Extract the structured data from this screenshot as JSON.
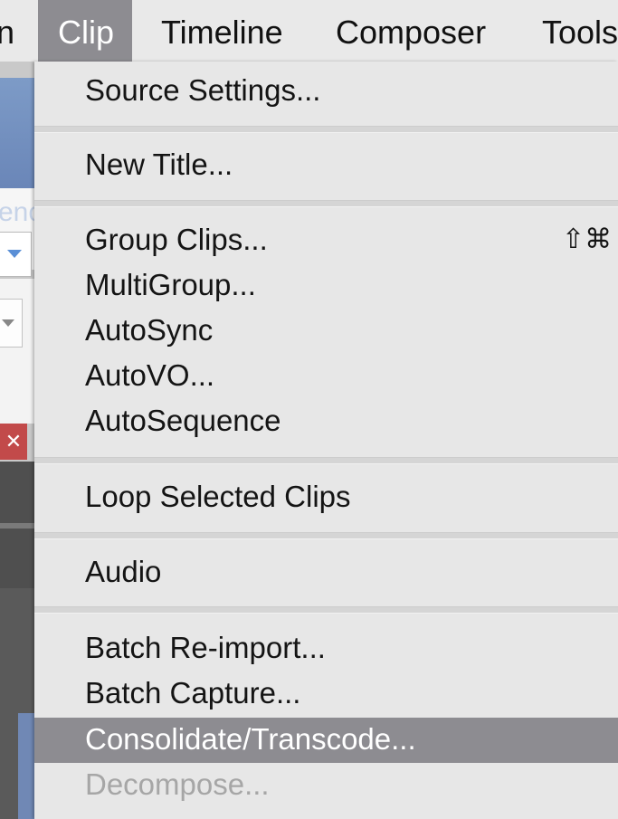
{
  "menubar": {
    "items": [
      {
        "label": "n"
      },
      {
        "label": "Clip"
      },
      {
        "label": "Timeline"
      },
      {
        "label": "Composer"
      },
      {
        "label": "Tools"
      }
    ]
  },
  "background": {
    "partial_text": "enc",
    "close_glyph": "✕"
  },
  "menu": {
    "items": [
      {
        "label": "Source Settings..."
      },
      {
        "label": "New Title..."
      },
      {
        "label": "Group Clips...",
        "shortcut": "⇧⌘"
      },
      {
        "label": "MultiGroup..."
      },
      {
        "label": "AutoSync"
      },
      {
        "label": "AutoVO..."
      },
      {
        "label": "AutoSequence"
      },
      {
        "label": "Loop Selected Clips"
      },
      {
        "label": "Audio"
      },
      {
        "label": "Batch Re-import..."
      },
      {
        "label": "Batch Capture..."
      },
      {
        "label": "Consolidate/Transcode...",
        "state": "highlighted"
      },
      {
        "label": "Decompose...",
        "state": "disabled"
      }
    ]
  },
  "colors": {
    "highlight": "#8d8c91",
    "menu_bg": "#e7e7e7",
    "disabled_text": "#a6a6a6"
  }
}
